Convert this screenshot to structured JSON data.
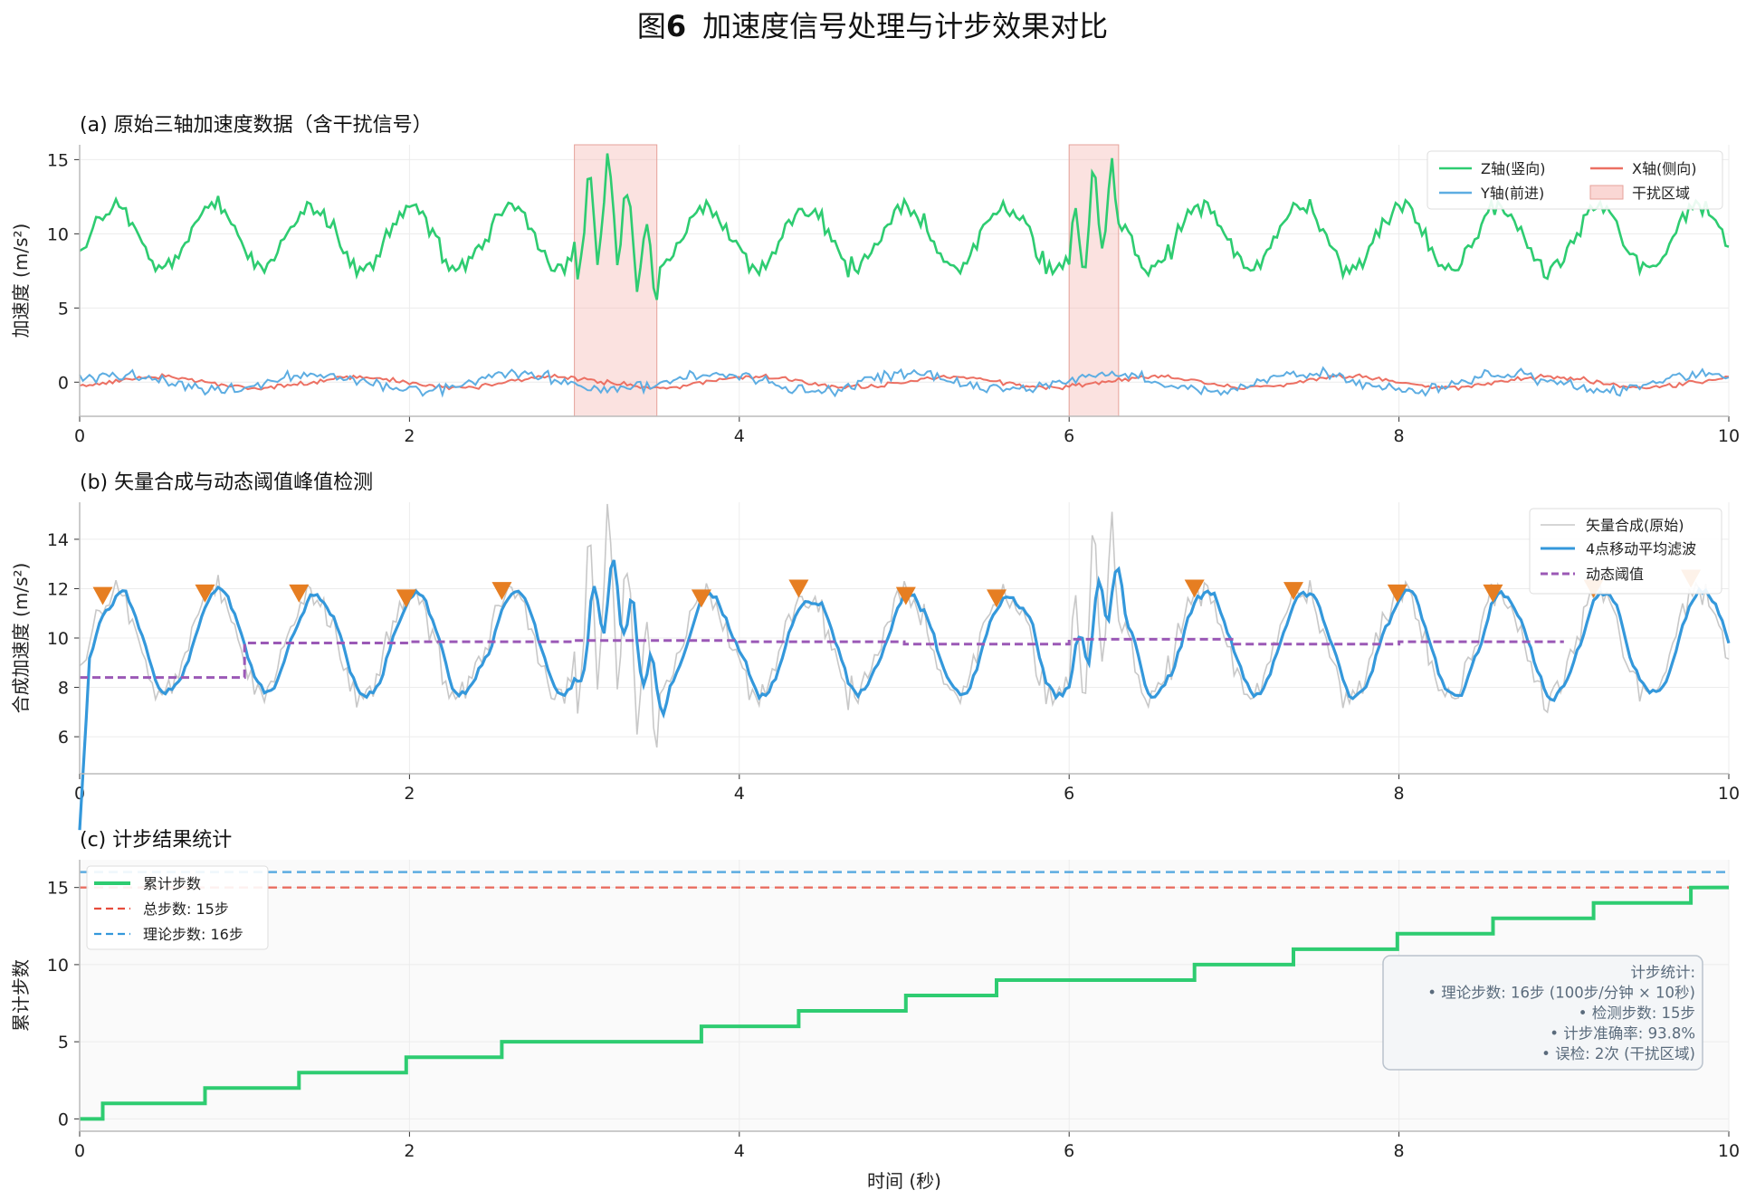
{
  "figure": {
    "title_prefix": "图",
    "title_number": "6",
    "title_text": "加速度信号处理与计步效果对比"
  },
  "chart_data": [
    {
      "type": "line",
      "title": "(a) 原始三轴加速度数据（含干扰信号）",
      "xlabel": "",
      "ylabel": "加速度 (m/s²)",
      "xlim": [
        0,
        10
      ],
      "ylim": [
        -2.3,
        16
      ],
      "xticks": [
        0,
        2,
        4,
        6,
        8,
        10
      ],
      "yticks": [
        0,
        5,
        10,
        15
      ],
      "grid": true,
      "legend_position": "top-right",
      "legend_columns": 2,
      "step_period_s": 0.6,
      "interference_regions": [
        [
          3.0,
          3.5
        ],
        [
          6.0,
          6.3
        ]
      ],
      "series": [
        {
          "name": "Z轴(竖向)",
          "color": "#2ecc71",
          "baseline": 9.8,
          "amplitude": 2.1,
          "noise": 0.6
        },
        {
          "name": "Y轴(前进)",
          "color": "#5dade2",
          "baseline": 0,
          "amplitude": 0.55,
          "noise": 0.35
        },
        {
          "name": "X轴(侧向)",
          "color": "#ec7063",
          "baseline": 0,
          "amplitude": 0.35,
          "noise": 0.15
        },
        {
          "name": "干扰区域",
          "color": "#f5b7b1",
          "kind": "span"
        }
      ]
    },
    {
      "type": "line",
      "title": "(b) 矢量合成与动态阈值峰值检测",
      "xlabel": "",
      "ylabel": "合成加速度 (m/s²)",
      "xlim": [
        0,
        10
      ],
      "ylim": [
        4.5,
        15.5
      ],
      "xticks": [
        0,
        2,
        4,
        6,
        8,
        10
      ],
      "yticks": [
        6,
        8,
        10,
        12,
        14
      ],
      "grid": true,
      "legend_position": "top-right",
      "series": [
        {
          "name": "矢量合成(原始)",
          "color": "#c8c8c8"
        },
        {
          "name": "4点移动平均滤波",
          "color": "#3498db"
        },
        {
          "name": "动态阈值",
          "color": "#9b59b6",
          "style": "dashed"
        }
      ],
      "threshold_segments": [
        {
          "x": [
            0,
            1
          ],
          "y": 8.4
        },
        {
          "x": [
            1,
            2
          ],
          "y": 9.8
        },
        {
          "x": [
            2,
            3
          ],
          "y": 9.85
        },
        {
          "x": [
            3,
            4
          ],
          "y": 9.9
        },
        {
          "x": [
            4,
            5
          ],
          "y": 9.85
        },
        {
          "x": [
            5,
            6
          ],
          "y": 9.75
        },
        {
          "x": [
            6,
            7
          ],
          "y": 9.95
        },
        {
          "x": [
            7,
            8
          ],
          "y": 9.75
        },
        {
          "x": [
            8,
            9
          ],
          "y": 9.85
        }
      ],
      "peaks": {
        "color": "#e67e22",
        "x": [
          0.14,
          0.76,
          1.33,
          1.98,
          2.56,
          3.77,
          4.36,
          5.01,
          5.56,
          6.76,
          7.36,
          7.99,
          8.57,
          9.18,
          9.77
        ],
        "y": [
          11.7,
          11.8,
          11.8,
          11.6,
          11.9,
          11.6,
          12.0,
          11.7,
          11.6,
          12.0,
          11.9,
          11.8,
          11.8,
          12.0,
          12.4
        ]
      }
    },
    {
      "type": "line",
      "title": "(c) 计步结果统计",
      "xlabel": "时间 (秒)",
      "ylabel": "累计步数",
      "xlim": [
        0,
        10
      ],
      "ylim": [
        -0.8,
        16.8
      ],
      "xticks": [
        0,
        2,
        4,
        6,
        8,
        10
      ],
      "yticks": [
        0,
        5,
        10,
        15
      ],
      "grid": true,
      "legend_position": "top-left",
      "series": [
        {
          "name": "累计步数",
          "color": "#2ecc71",
          "kind": "step",
          "x": [
            0.14,
            0.76,
            1.33,
            1.98,
            2.56,
            3.77,
            4.36,
            5.01,
            5.56,
            6.76,
            7.36,
            7.99,
            8.57,
            9.18,
            9.77
          ],
          "y": [
            1,
            2,
            3,
            4,
            5,
            6,
            7,
            8,
            9,
            10,
            11,
            12,
            13,
            14,
            15
          ]
        },
        {
          "name": "总步数: 15步",
          "color": "#e74c3c",
          "kind": "hline",
          "y": 15
        },
        {
          "name": "理论步数: 16步",
          "color": "#3498db",
          "kind": "hline",
          "y": 16
        }
      ],
      "annotation": [
        "计步统计:",
        "• 理论步数: 16步 (100步/分钟 × 10秒)",
        "• 检测步数: 15步",
        "• 计步准确率: 93.8%",
        "• 误检: 2次 (干扰区域)"
      ]
    }
  ]
}
